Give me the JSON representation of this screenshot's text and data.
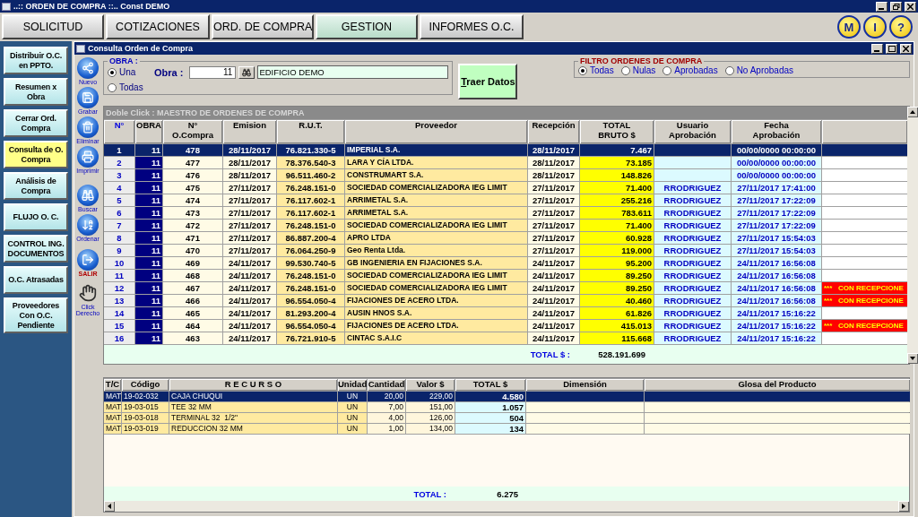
{
  "window": {
    "title": "..:: ORDEN DE COMPRA ::.. Const DEMO"
  },
  "menu": [
    {
      "label": "SOLICITUD",
      "selected": false
    },
    {
      "label": "COTIZACIONES",
      "selected": false
    },
    {
      "label": "ORD. DE COMPRA",
      "selected": false
    },
    {
      "label": "GESTION",
      "selected": true
    },
    {
      "label": "INFORMES O.C.",
      "selected": false
    }
  ],
  "round_buttons": [
    "M",
    "I",
    "?"
  ],
  "sidebar": {
    "items": [
      {
        "label": "Distribuir O.C. en PPTO.",
        "selected": false
      },
      {
        "label": "Resumen x Obra",
        "selected": false
      },
      {
        "label": "Cerrar Ord. Compra",
        "selected": false
      },
      {
        "label": "Consulta de O. Compra",
        "selected": true
      },
      {
        "label": "Análisis de Compra",
        "selected": false
      },
      {
        "label": "FLUJO O. C.",
        "selected": false
      },
      {
        "label": "CONTROL ING. DOCUMENTOS",
        "selected": false
      },
      {
        "label": "O.C. Atrasadas",
        "selected": false
      },
      {
        "label": "Proveedores Con O.C. Pendiente",
        "selected": false
      }
    ]
  },
  "subwindow": {
    "title": "Consulta Orden de Compra"
  },
  "toolbar": [
    {
      "kind": "new",
      "label": "Nuevo"
    },
    {
      "kind": "save",
      "label": "Grabar"
    },
    {
      "kind": "delete",
      "label": "Eliminar"
    },
    {
      "kind": "print",
      "label": "Imprimir"
    },
    {
      "kind": "search",
      "label": "Buscar"
    },
    {
      "kind": "sort",
      "label": "Ordenar"
    },
    {
      "kind": "exit",
      "label": "SALIR"
    },
    {
      "kind": "hint",
      "label": "Click Derecho"
    }
  ],
  "obra": {
    "title": "OBRA :",
    "options": [
      {
        "label": "Una",
        "selected": true
      },
      {
        "label": "Todas",
        "selected": false
      }
    ],
    "field_label": "Obra :",
    "code": "11",
    "name": "EDIFICIO DEMO"
  },
  "fetch_button": "Traer Datos",
  "filter": {
    "title": "FILTRO ORDENES DE COMPRA",
    "options": [
      {
        "label": "Todas",
        "selected": true
      },
      {
        "label": "Nulas",
        "selected": false
      },
      {
        "label": "Aprobadas",
        "selected": false
      },
      {
        "label": "No Aprobadas",
        "selected": false
      }
    ]
  },
  "orders": {
    "caption": "Doble Click : MAESTRO DE ORDENES DE COMPRA",
    "columns": [
      "N°",
      "OBRA",
      "N°\nO.Compra",
      "Emision",
      "R.U.T.",
      "Proveedor",
      "Recepción",
      "TOTAL\nBRUTO $",
      "Usuario\nAprobación",
      "Fecha\nAprobación"
    ],
    "rows": [
      {
        "n": "1",
        "obra": "11",
        "oc": "478",
        "emision": "28/11/2017",
        "rut": "76.821.330-5",
        "proveedor": "IMPERIAL S.A.",
        "recepcion": "28/11/2017",
        "total": "7.467",
        "fecha": "00/00/0000 00:00:00",
        "selected": true
      },
      {
        "n": "2",
        "obra": "11",
        "oc": "477",
        "emision": "28/11/2017",
        "rut": "78.376.540-3",
        "proveedor": "LARA Y CÍA LTDA.",
        "recepcion": "28/11/2017",
        "total": "73.185",
        "fecha": "00/00/0000 00:00:00",
        "selected": false
      },
      {
        "n": "3",
        "obra": "11",
        "oc": "476",
        "emision": "28/11/2017",
        "rut": "96.511.460-2",
        "proveedor": "CONSTRUMART S.A.",
        "recepcion": "28/11/2017",
        "total": "148.826",
        "fecha": "00/00/0000 00:00:00",
        "selected": false
      },
      {
        "n": "4",
        "obra": "11",
        "oc": "475",
        "emision": "27/11/2017",
        "rut": "76.248.151-0",
        "proveedor": "SOCIEDAD COMERCIALIZADORA IEG LIMIT",
        "recepcion": "27/11/2017",
        "total": "71.400",
        "usuario": "RRODRIGUEZ",
        "fecha": "27/11/2017 17:41:00",
        "selected": false
      },
      {
        "n": "5",
        "obra": "11",
        "oc": "474",
        "emision": "27/11/2017",
        "rut": "76.117.602-1",
        "proveedor": "ARRIMETAL S.A.",
        "recepcion": "27/11/2017",
        "total": "255.216",
        "usuario": "RRODRIGUEZ",
        "fecha": "27/11/2017 17:22:09",
        "selected": false
      },
      {
        "n": "6",
        "obra": "11",
        "oc": "473",
        "emision": "27/11/2017",
        "rut": "76.117.602-1",
        "proveedor": "ARRIMETAL S.A.",
        "recepcion": "27/11/2017",
        "total": "783.611",
        "usuario": "RRODRIGUEZ",
        "fecha": "27/11/2017 17:22:09",
        "selected": false
      },
      {
        "n": "7",
        "obra": "11",
        "oc": "472",
        "emision": "27/11/2017",
        "rut": "76.248.151-0",
        "proveedor": "SOCIEDAD COMERCIALIZADORA IEG LIMIT",
        "recepcion": "27/11/2017",
        "total": "71.400",
        "usuario": "RRODRIGUEZ",
        "fecha": "27/11/2017 17:22:09",
        "selected": false
      },
      {
        "n": "8",
        "obra": "11",
        "oc": "471",
        "emision": "27/11/2017",
        "rut": "86.887.200-4",
        "proveedor": "APRO LTDA",
        "recepcion": "27/11/2017",
        "total": "60.928",
        "usuario": "RRODRIGUEZ",
        "fecha": "27/11/2017 15:54:03",
        "selected": false
      },
      {
        "n": "9",
        "obra": "11",
        "oc": "470",
        "emision": "27/11/2017",
        "rut": "76.064.250-9",
        "proveedor": "Geo Renta Ltda.",
        "recepcion": "27/11/2017",
        "total": "119.000",
        "usuario": "RRODRIGUEZ",
        "fecha": "27/11/2017 15:54:03",
        "selected": false
      },
      {
        "n": "10",
        "obra": "11",
        "oc": "469",
        "emision": "24/11/2017",
        "rut": "99.530.740-5",
        "proveedor": "GB INGENIERIA EN FIJACIONES S.A.",
        "recepcion": "24/11/2017",
        "total": "95.200",
        "usuario": "RRODRIGUEZ",
        "fecha": "24/11/2017 16:56:08",
        "selected": false
      },
      {
        "n": "11",
        "obra": "11",
        "oc": "468",
        "emision": "24/11/2017",
        "rut": "76.248.151-0",
        "proveedor": "SOCIEDAD COMERCIALIZADORA IEG LIMIT",
        "recepcion": "24/11/2017",
        "total": "89.250",
        "usuario": "RRODRIGUEZ",
        "fecha": "24/11/2017 16:56:08",
        "selected": false
      },
      {
        "n": "12",
        "obra": "11",
        "oc": "467",
        "emision": "24/11/2017",
        "rut": "76.248.151-0",
        "proveedor": "SOCIEDAD COMERCIALIZADORA IEG LIMIT",
        "recepcion": "24/11/2017",
        "total": "89.250",
        "usuario": "RRODRIGUEZ",
        "fecha": "24/11/2017 16:56:08",
        "flag": "***   CON RECEPCIONE",
        "selected": false
      },
      {
        "n": "13",
        "obra": "11",
        "oc": "466",
        "emision": "24/11/2017",
        "rut": "96.554.050-4",
        "proveedor": "FIJACIONES DE ACERO LTDA.",
        "recepcion": "24/11/2017",
        "total": "40.460",
        "usuario": "RRODRIGUEZ",
        "fecha": "24/11/2017 16:56:08",
        "flag": "***   CON RECEPCIONE",
        "selected": false
      },
      {
        "n": "14",
        "obra": "11",
        "oc": "465",
        "emision": "24/11/2017",
        "rut": "81.293.200-4",
        "proveedor": "AUSIN HNOS S.A.",
        "recepcion": "24/11/2017",
        "total": "61.826",
        "usuario": "RRODRIGUEZ",
        "fecha": "24/11/2017 15:16:22",
        "selected": false
      },
      {
        "n": "15",
        "obra": "11",
        "oc": "464",
        "emision": "24/11/2017",
        "rut": "96.554.050-4",
        "proveedor": "FIJACIONES DE ACERO LTDA.",
        "recepcion": "24/11/2017",
        "total": "415.013",
        "usuario": "RRODRIGUEZ",
        "fecha": "24/11/2017 15:16:22",
        "flag": "***   CON RECEPCIONE",
        "selected": false
      },
      {
        "n": "16",
        "obra": "11",
        "oc": "463",
        "emision": "24/11/2017",
        "rut": "76.721.910-5",
        "proveedor": "CINTAC S.A.I.C",
        "recepcion": "24/11/2017",
        "total": "115.668",
        "usuario": "RRODRIGUEZ",
        "fecha": "24/11/2017 15:16:22",
        "selected": false
      }
    ],
    "total_label": "TOTAL $ :",
    "total_value": "528.191.699"
  },
  "items": {
    "columns": [
      "T/C",
      "Código",
      "R E C U R S O",
      "Unidad",
      "Cantidad",
      "Valor $",
      "TOTAL $",
      "Dimensión",
      "Glosa del Producto"
    ],
    "rows": [
      {
        "tc": "MAT",
        "codigo": "19-02-032",
        "recurso": "CAJA CHUQUI",
        "unidad": "UN",
        "cantidad": "20,00",
        "valor": "229,00",
        "total": "4.580",
        "selected": true
      },
      {
        "tc": "MAT",
        "codigo": "19-03-015",
        "recurso": "TEE 32 MM",
        "unidad": "UN",
        "cantidad": "7,00",
        "valor": "151,00",
        "total": "1.057",
        "selected": false
      },
      {
        "tc": "MAT",
        "codigo": "19-03-018",
        "recurso": "TERMINAL 32  1/2\"",
        "unidad": "UN",
        "cantidad": "4,00",
        "valor": "126,00",
        "total": "504",
        "selected": false
      },
      {
        "tc": "MAT",
        "codigo": "19-03-019",
        "recurso": "REDUCCION 32 MM",
        "unidad": "UN",
        "cantidad": "1,00",
        "valor": "134,00",
        "total": "134",
        "selected": false
      }
    ],
    "total_label": "TOTAL :",
    "total_value": "6.275"
  }
}
